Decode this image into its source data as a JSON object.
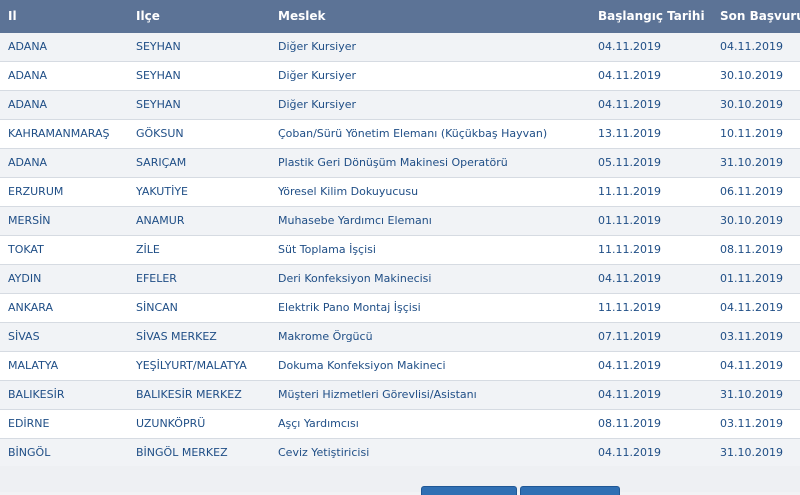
{
  "table": {
    "headers": {
      "il": "Il",
      "ilce": "Ilçe",
      "meslek": "Meslek",
      "baslangic": "Başlangıç Tarihi",
      "son": "Son Başvuru"
    },
    "rows": [
      {
        "il": "ADANA",
        "ilce": "SEYHAN",
        "meslek": "Diğer Kursiyer",
        "baslangic": "04.11.2019",
        "son": "04.11.2019"
      },
      {
        "il": "ADANA",
        "ilce": "SEYHAN",
        "meslek": "Diğer Kursiyer",
        "baslangic": "04.11.2019",
        "son": "30.10.2019"
      },
      {
        "il": "ADANA",
        "ilce": "SEYHAN",
        "meslek": "Diğer Kursiyer",
        "baslangic": "04.11.2019",
        "son": "30.10.2019"
      },
      {
        "il": "KAHRAMANMARAŞ",
        "ilce": "GÖKSUN",
        "meslek": "Çoban/Sürü Yönetim Elemanı (Küçükbaş Hayvan)",
        "baslangic": "13.11.2019",
        "son": "10.11.2019"
      },
      {
        "il": "ADANA",
        "ilce": "SARIÇAM",
        "meslek": "Plastik Geri Dönüşüm Makinesi Operatörü",
        "baslangic": "05.11.2019",
        "son": "31.10.2019"
      },
      {
        "il": "ERZURUM",
        "ilce": "YAKUTİYE",
        "meslek": "Yöresel Kilim Dokuyucusu",
        "baslangic": "11.11.2019",
        "son": "06.11.2019"
      },
      {
        "il": "MERSİN",
        "ilce": "ANAMUR",
        "meslek": "Muhasebe Yardımcı Elemanı",
        "baslangic": "01.11.2019",
        "son": "30.10.2019"
      },
      {
        "il": "TOKAT",
        "ilce": "ZİLE",
        "meslek": "Süt Toplama İşçisi",
        "baslangic": "11.11.2019",
        "son": "08.11.2019"
      },
      {
        "il": "AYDIN",
        "ilce": "EFELER",
        "meslek": "Deri Konfeksiyon Makinecisi",
        "baslangic": "04.11.2019",
        "son": "01.11.2019"
      },
      {
        "il": "ANKARA",
        "ilce": "SİNCAN",
        "meslek": "Elektrik Pano Montaj İşçisi",
        "baslangic": "11.11.2019",
        "son": "04.11.2019"
      },
      {
        "il": "SİVAS",
        "ilce": "SİVAS MERKEZ",
        "meslek": "Makrome Örgücü",
        "baslangic": "07.11.2019",
        "son": "03.11.2019"
      },
      {
        "il": "MALATYA",
        "ilce": "YEŞİLYURT/MALATYA",
        "meslek": "Dokuma Konfeksiyon Makineci",
        "baslangic": "04.11.2019",
        "son": "04.11.2019"
      },
      {
        "il": "BALIKESİR",
        "ilce": "BALIKESİR MERKEZ",
        "meslek": "Müşteri Hizmetleri Görevlisi/Asistanı",
        "baslangic": "04.11.2019",
        "son": "31.10.2019"
      },
      {
        "il": "EDİRNE",
        "ilce": "UZUNKÖPRÜ",
        "meslek": "Aşçı Yardımcısı",
        "baslangic": "08.11.2019",
        "son": "03.11.2019"
      },
      {
        "il": "BİNGÖL",
        "ilce": "BİNGÖL MERKEZ",
        "meslek": "Ceviz Yetiştiricisi",
        "baslangic": "04.11.2019",
        "son": "31.10.2019"
      }
    ]
  },
  "colors": {
    "header_bg": "#5c7396",
    "link_text": "#1f4e86",
    "row_alt": "#f1f3f6",
    "button": "#2f6fb3"
  }
}
